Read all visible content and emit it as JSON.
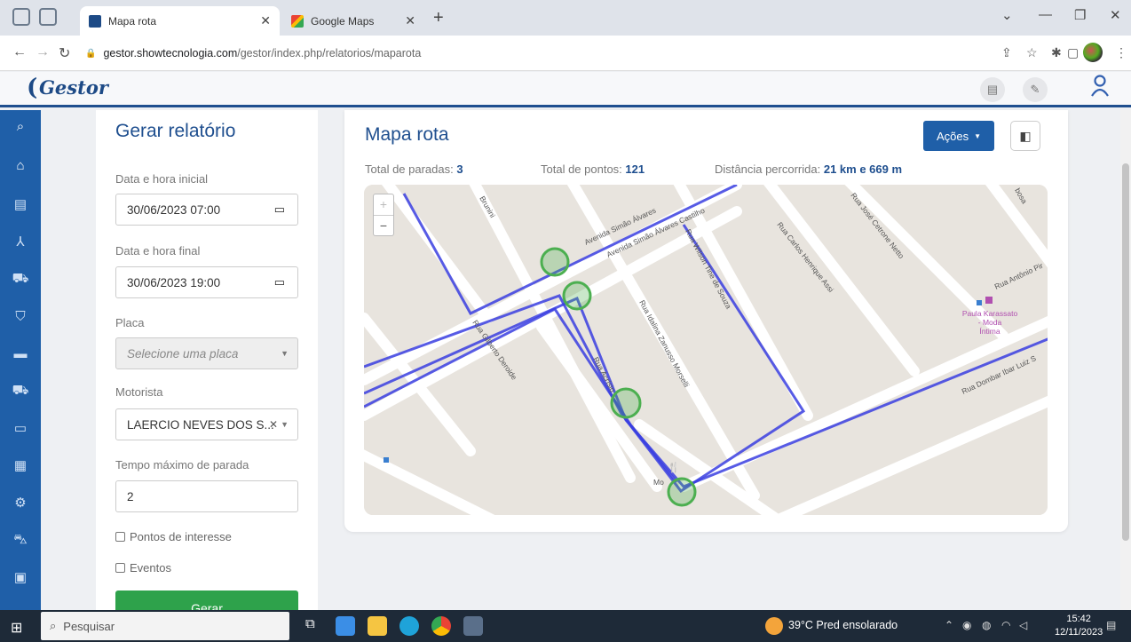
{
  "browser": {
    "tabs": [
      {
        "title": "Mapa rota",
        "active": true
      },
      {
        "title": "Google Maps",
        "active": false
      }
    ],
    "url_host": "gestor.showtecnologia.com",
    "url_path": "/gestor/index.php/relatorios/maparota"
  },
  "app": {
    "logo": "Gestor"
  },
  "form": {
    "title": "Gerar relatório",
    "start_label": "Data e hora inicial",
    "start_value": "30/06/2023 07:00",
    "end_label": "Data e hora final",
    "end_value": "30/06/2023 19:00",
    "plate_label": "Placa",
    "plate_placeholder": "Selecione uma placa",
    "driver_label": "Motorista",
    "driver_value": "LAERCIO NEVES DOS S...",
    "stop_label": "Tempo máximo de parada",
    "stop_value": "2",
    "poi_label": "Pontos de interesse",
    "events_label": "Eventos",
    "submit_label": "Gerar"
  },
  "map_card": {
    "title": "Mapa rota",
    "actions_label": "Ações",
    "stops_label": "Total de paradas:",
    "stops_value": "3",
    "points_label": "Total de pontos:",
    "points_value": "121",
    "distance_label": "Distância percorrida:",
    "distance_value": "21 km e 669 m",
    "zoom_in": "+",
    "zoom_out": "−"
  },
  "map": {
    "streets": [
      "Brunini",
      "Avenida Simão Álvares",
      "Avenida Simão Álvares Castilho",
      "Rua Wilson Tine de Souza",
      "Rua Carlos Henrique Assi",
      "Rua José Cetrone Netto",
      "bosa",
      "Rua Antônio Pir",
      "Rua Idalina Zanusso Morselli",
      "Rua Gilberto Deroide",
      "Rua Acrísio",
      "Rua Dombar Ibar Luiz S",
      "Mo"
    ],
    "poi": [
      "Paula Karassato",
      "- Moda",
      "Íntima"
    ],
    "colors": {
      "route": "#3a3ee0",
      "stop": "#4caf50",
      "road": "#ffffff",
      "land": "#e8e4de"
    }
  },
  "taskbar": {
    "search_placeholder": "Pesquisar",
    "weather": "39°C  Pred ensolarado",
    "time": "15:42",
    "date": "12/11/2023"
  }
}
